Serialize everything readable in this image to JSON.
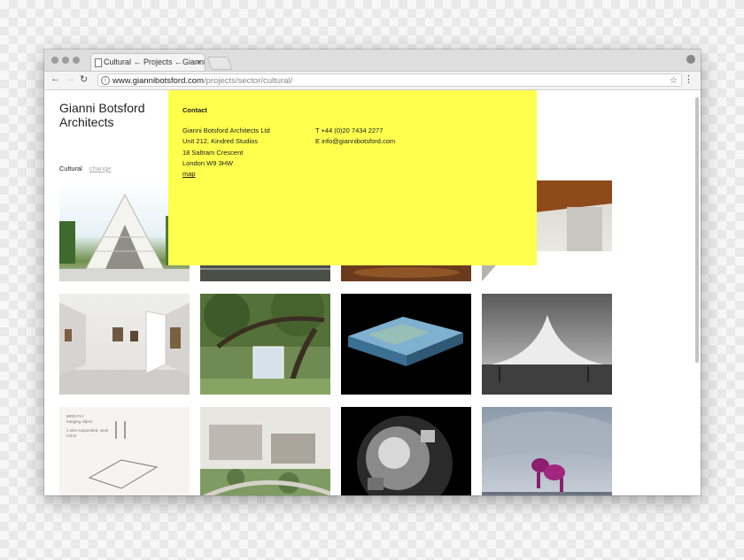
{
  "browser": {
    "tab_title": "Cultural ← Projects ←Gianni B",
    "tab_close": "×",
    "url_domain": "www.giannibotsford.com",
    "url_path": "/projects/sector/cultural/",
    "back": "←",
    "forward": "→",
    "reload": "↻",
    "star": "☆",
    "menu": "⋮",
    "info": "i"
  },
  "site": {
    "brand_line1": "Gianni Botsford",
    "brand_line2": "Architects",
    "filter_label": "Cultural",
    "filter_change": "change"
  },
  "contact": {
    "heading": "Contact",
    "company": "Gianni Botsford Architects Ltd",
    "address_line1": "Unit 212, Kindred Studios",
    "address_line2": "18 Saltram Crescent",
    "address_line3": "London W9 3HW",
    "map_link": "map",
    "phone": "T +44 (0)20 7434 2277",
    "email": "E info@giannibotsford.com",
    "accent_color": "#ffff4d"
  },
  "thumb_note": {
    "line1": "BIRD FLY",
    "line2": "hanging object",
    "line3": "1 wire suspended, steel",
    "line4": "mirror"
  },
  "icons": [
    "page-icon",
    "close-icon",
    "back-arrow-icon",
    "forward-arrow-icon",
    "reload-icon",
    "info-icon",
    "star-icon",
    "menu-icon",
    "profile-icon"
  ]
}
